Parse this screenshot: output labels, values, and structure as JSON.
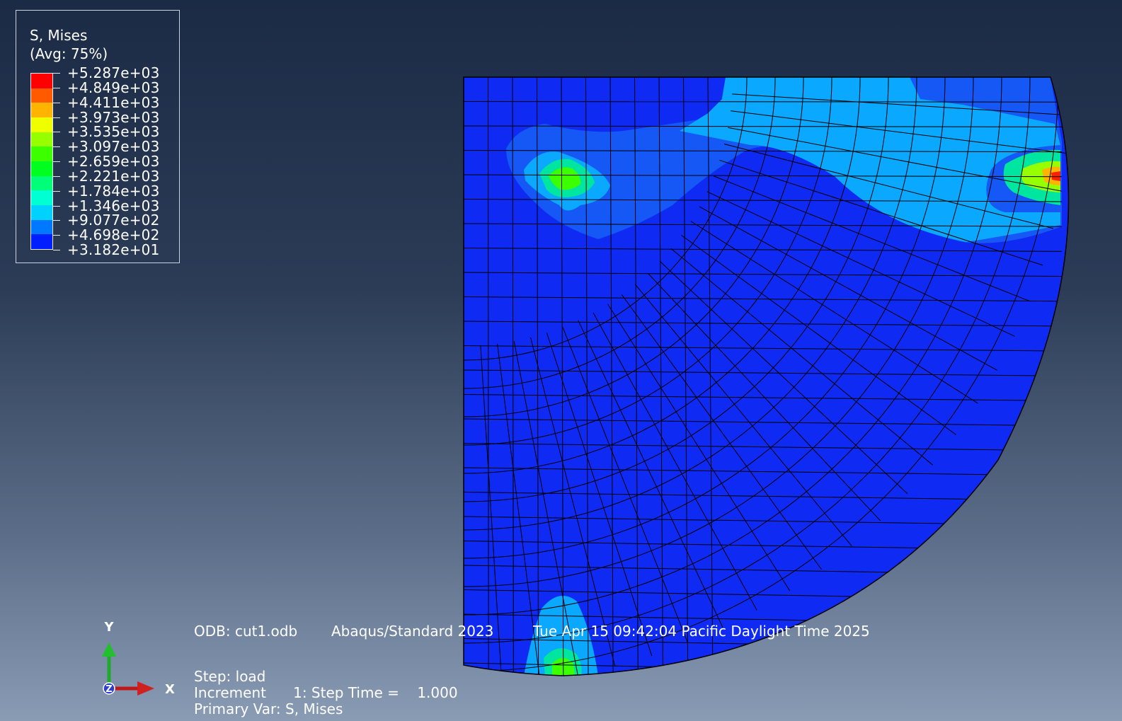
{
  "legend": {
    "title": "S, Mises",
    "avg": "(Avg: 75%)",
    "values": [
      "+5.287e+03",
      "+4.849e+03",
      "+4.411e+03",
      "+3.973e+03",
      "+3.535e+03",
      "+3.097e+03",
      "+2.659e+03",
      "+2.221e+03",
      "+1.784e+03",
      "+1.346e+03",
      "+9.077e+02",
      "+4.698e+02",
      "+3.182e+01"
    ],
    "colors": [
      "#ff0000",
      "#ff5a00",
      "#ffb400",
      "#f0ff00",
      "#96ff00",
      "#3cff00",
      "#00ff1e",
      "#00ff78",
      "#00ffd2",
      "#00d2ff",
      "#0078ff",
      "#001eff"
    ]
  },
  "info": {
    "odb": "ODB: cut1.odb",
    "solver": "Abaqus/Standard 2023",
    "timestamp": "Tue Apr 15 09:42:04 Pacific Daylight Time 2025",
    "step": "Step: load",
    "increment": "Increment      1: Step Time =    1.000",
    "primary_var": "Primary Var: S, Mises"
  },
  "triad": {
    "y": "Y",
    "x": "X",
    "z": "Z"
  },
  "model": {
    "base_color": "#0f2bf3",
    "mid_color": "#1558f5",
    "light_color": "#0aa8ff",
    "mesh_color": "#000000"
  }
}
